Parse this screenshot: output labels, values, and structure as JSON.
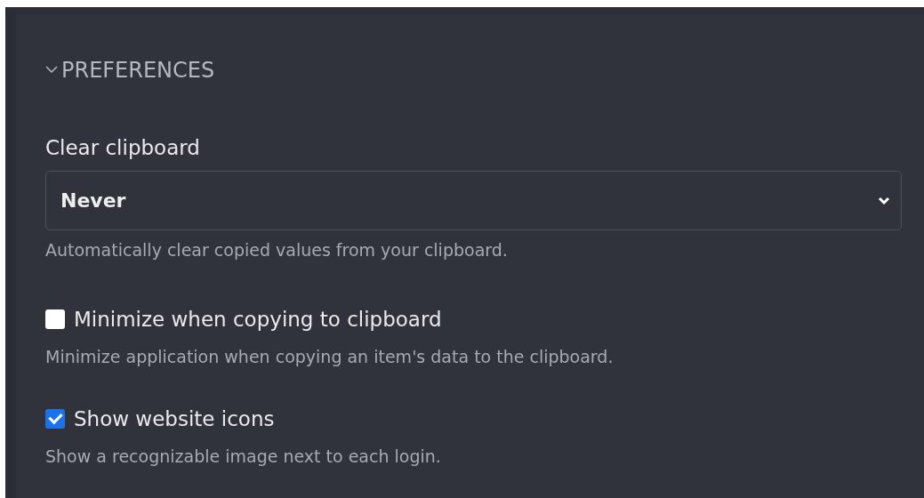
{
  "section": {
    "title": "PREFERENCES",
    "expanded": true
  },
  "settings": [
    {
      "kind": "select",
      "label": "Clear clipboard",
      "value": "Never",
      "help": "Automatically clear copied values from your clipboard."
    },
    {
      "kind": "checkbox",
      "label": "Minimize when copying to clipboard",
      "checked": false,
      "help": "Minimize application when copying an item's data to the clipboard."
    },
    {
      "kind": "checkbox",
      "label": "Show website icons",
      "checked": true,
      "help": "Show a recognizable image next to each login."
    }
  ]
}
